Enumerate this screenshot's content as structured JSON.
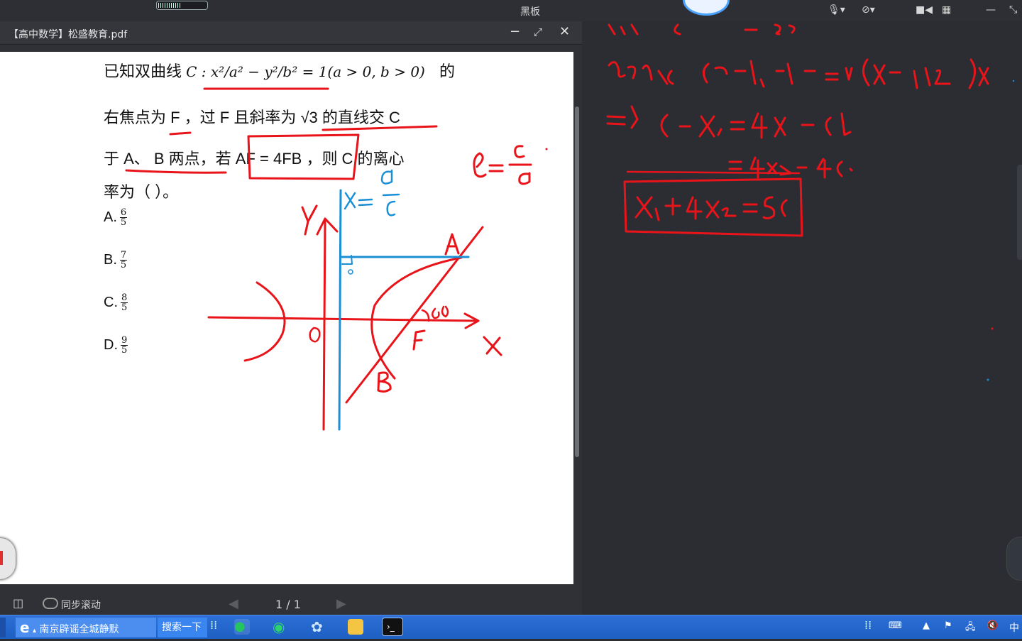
{
  "topbar": {
    "center_title": "黑板"
  },
  "pdf": {
    "title": "【高中数学】松盛教育.pdf",
    "question": {
      "line1": "已知双曲线",
      "line1_math": "C : x²/a² − y²/b² = 1(a > 0, b > 0)",
      "line1_end": "的",
      "line2": "右焦点为 F ，过 F 且斜率为 √3 的直线交 C",
      "line3": "于 A、 B 两点，若 AF = 4FB ，则 C 的离心",
      "line4": "率为（ ）。"
    },
    "options": [
      {
        "label": "A.",
        "num": "6",
        "den": "5"
      },
      {
        "label": "B.",
        "num": "7",
        "den": "5"
      },
      {
        "label": "C.",
        "num": "8",
        "den": "5"
      },
      {
        "label": "D.",
        "num": "9",
        "den": "5"
      }
    ],
    "footer": {
      "sync_scroll": "同步滚动",
      "page_indicator": "1 / 1"
    }
  },
  "taskbar": {
    "browser_label": "南京辟谣全城静默",
    "search_label": "搜索一下",
    "ime_label": "中"
  },
  "colors": {
    "ink_red": "#e8141a",
    "ink_blue": "#1a8fd6",
    "taskbar_blue": "#2c6fd6"
  }
}
